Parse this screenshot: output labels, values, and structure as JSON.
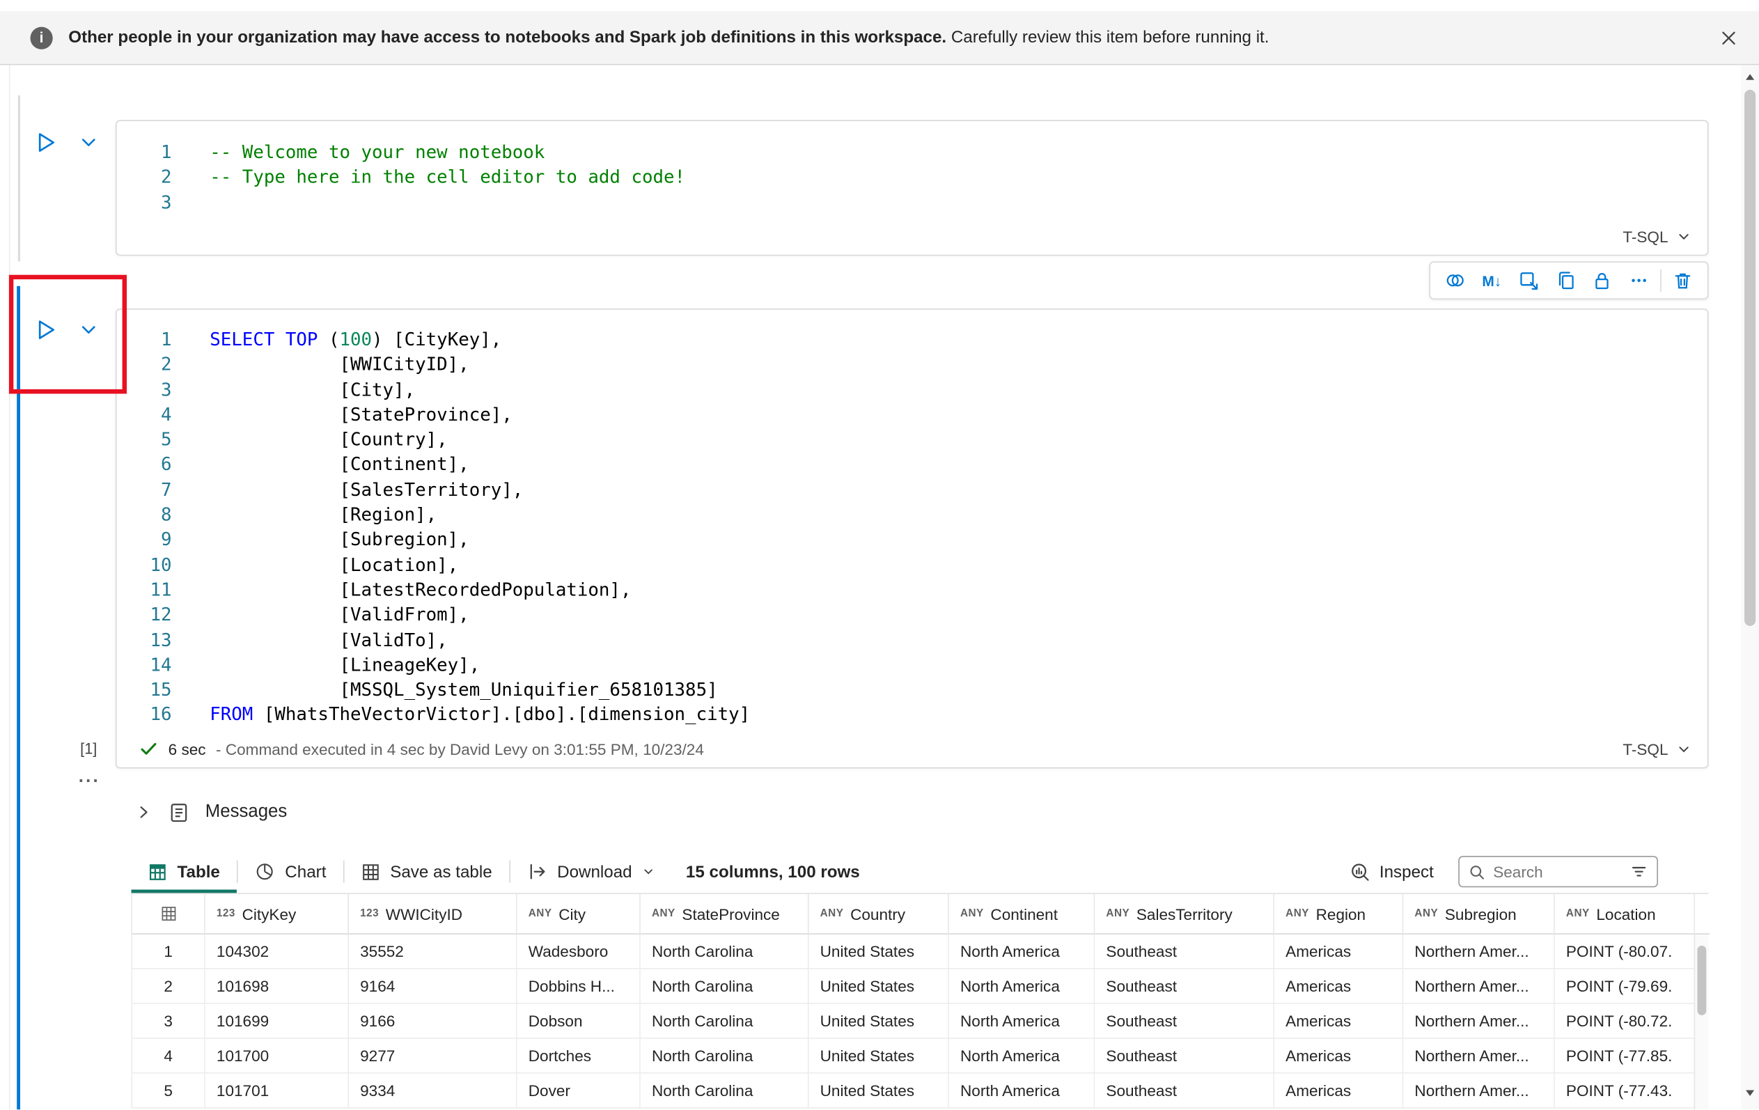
{
  "banner": {
    "message_bold": "Other people in your organization may have access to notebooks and Spark job definitions in this workspace.",
    "message_rest": "Carefully review this item before running it."
  },
  "cells": {
    "cell1": {
      "language": "T-SQL",
      "lines": [
        {
          "num": "1",
          "tokens": [
            [
              "c",
              "-- Welcome to your new notebook"
            ]
          ]
        },
        {
          "num": "2",
          "tokens": [
            [
              "c",
              "-- Type here in the cell editor to add code!"
            ]
          ]
        },
        {
          "num": "3",
          "tokens": []
        }
      ]
    },
    "cell2": {
      "language": "T-SQL",
      "execution_count": "[1]",
      "more_indicator": "...",
      "status": {
        "duration": "6 sec",
        "detail": "- Command executed in 4 sec by David Levy on 3:01:55 PM, 10/23/24"
      },
      "lines": [
        {
          "num": "1",
          "tokens": [
            [
              "k",
              "SELECT"
            ],
            [
              "p",
              " "
            ],
            [
              "k",
              "TOP"
            ],
            [
              "p",
              " ("
            ],
            [
              "n",
              "100"
            ],
            [
              "p",
              ") [CityKey],"
            ]
          ]
        },
        {
          "num": "2",
          "tokens": [
            [
              "p",
              "            [WWICityID],"
            ]
          ]
        },
        {
          "num": "3",
          "tokens": [
            [
              "p",
              "            [City],"
            ]
          ]
        },
        {
          "num": "4",
          "tokens": [
            [
              "p",
              "            [StateProvince],"
            ]
          ]
        },
        {
          "num": "5",
          "tokens": [
            [
              "p",
              "            [Country],"
            ]
          ]
        },
        {
          "num": "6",
          "tokens": [
            [
              "p",
              "            [Continent],"
            ]
          ]
        },
        {
          "num": "7",
          "tokens": [
            [
              "p",
              "            [SalesTerritory],"
            ]
          ]
        },
        {
          "num": "8",
          "tokens": [
            [
              "p",
              "            [Region],"
            ]
          ]
        },
        {
          "num": "9",
          "tokens": [
            [
              "p",
              "            [Subregion],"
            ]
          ]
        },
        {
          "num": "10",
          "tokens": [
            [
              "p",
              "            [Location],"
            ]
          ]
        },
        {
          "num": "11",
          "tokens": [
            [
              "p",
              "            [LatestRecordedPopulation],"
            ]
          ]
        },
        {
          "num": "12",
          "tokens": [
            [
              "p",
              "            [ValidFrom],"
            ]
          ]
        },
        {
          "num": "13",
          "tokens": [
            [
              "p",
              "            [ValidTo],"
            ]
          ]
        },
        {
          "num": "14",
          "tokens": [
            [
              "p",
              "            [LineageKey],"
            ]
          ]
        },
        {
          "num": "15",
          "tokens": [
            [
              "p",
              "            [MSSQL_System_Uniquifier_658101385]"
            ]
          ]
        },
        {
          "num": "16",
          "tokens": [
            [
              "k",
              "FROM"
            ],
            [
              "p",
              " [WhatsTheVectorVictor].[dbo].[dimension_city]"
            ]
          ]
        }
      ]
    }
  },
  "messages_label": "Messages",
  "results": {
    "tab_table": "Table",
    "tab_chart": "Chart",
    "save_as_table": "Save as table",
    "download": "Download",
    "summary": "15 columns, 100 rows",
    "inspect": "Inspect",
    "search_placeholder": "Search",
    "grid": {
      "columns": [
        {
          "prefix": "123",
          "name": "CityKey"
        },
        {
          "prefix": "123",
          "name": "WWICityID"
        },
        {
          "prefix": "ANY",
          "name": "City"
        },
        {
          "prefix": "ANY",
          "name": "StateProvince"
        },
        {
          "prefix": "ANY",
          "name": "Country"
        },
        {
          "prefix": "ANY",
          "name": "Continent"
        },
        {
          "prefix": "ANY",
          "name": "SalesTerritory"
        },
        {
          "prefix": "ANY",
          "name": "Region"
        },
        {
          "prefix": "ANY",
          "name": "Subregion"
        },
        {
          "prefix": "ANY",
          "name": "Location"
        }
      ],
      "rows": [
        {
          "n": "1",
          "cells": [
            "104302",
            "35552",
            "Wadesboro",
            "North Carolina",
            "United States",
            "North America",
            "Southeast",
            "Americas",
            "Northern Amer...",
            "POINT (-80.07."
          ]
        },
        {
          "n": "2",
          "cells": [
            "101698",
            "9164",
            "Dobbins H...",
            "North Carolina",
            "United States",
            "North America",
            "Southeast",
            "Americas",
            "Northern Amer...",
            "POINT (-79.69."
          ]
        },
        {
          "n": "3",
          "cells": [
            "101699",
            "9166",
            "Dobson",
            "North Carolina",
            "United States",
            "North America",
            "Southeast",
            "Americas",
            "Northern Amer...",
            "POINT (-80.72."
          ]
        },
        {
          "n": "4",
          "cells": [
            "101700",
            "9277",
            "Dortches",
            "North Carolina",
            "United States",
            "North America",
            "Southeast",
            "Americas",
            "Northern Amer...",
            "POINT (-77.85."
          ]
        },
        {
          "n": "5",
          "cells": [
            "101701",
            "9334",
            "Dover",
            "North Carolina",
            "United States",
            "North America",
            "Southeast",
            "Americas",
            "Northern Amer...",
            "POINT (-77.43."
          ]
        }
      ]
    }
  },
  "colors": {
    "accent_blue": "#0078d4",
    "keyword_blue": "#0000ff",
    "comment_green": "#008000",
    "number_green": "#098658",
    "line_number": "#237893",
    "success_green": "#107c10",
    "annotation_red": "#e81123",
    "table_icon_green": "#117865"
  }
}
